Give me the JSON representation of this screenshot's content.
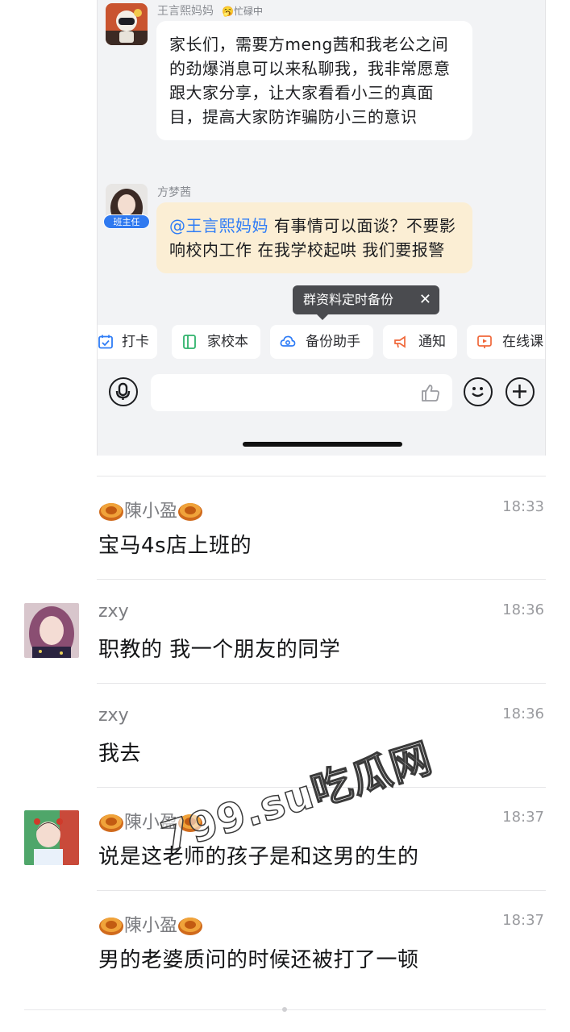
{
  "embed": {
    "sender1": {
      "name": "王言熙妈妈",
      "status": "🥱忙碌中"
    },
    "message1": "家长们，需要方meng茜和我老公之间的劲爆消息可以来私聊我，我非常愿意跟大家分享，让大家看看小三的真面目，提高大家防诈骗防小三的意识",
    "sender2": {
      "name": "方梦茜",
      "role": "班主任"
    },
    "message2": {
      "mention": "@王言熙妈妈",
      "text": " 有事情可以面谈？不要影响校内工作  在我学校起哄  我们要报警"
    },
    "tooltip": {
      "text": "群资料定时备份",
      "close": "✕"
    },
    "quick_actions": [
      {
        "label": "打卡",
        "icon": "calendar-check-icon",
        "color": "#2e7cf6"
      },
      {
        "label": "家校本",
        "icon": "notebook-icon",
        "color": "#2fb36b"
      },
      {
        "label": "备份助手",
        "icon": "cloud-backup-icon",
        "color": "#2e7cf6"
      },
      {
        "label": "通知",
        "icon": "megaphone-icon",
        "color": "#f0683a"
      },
      {
        "label": "在线课",
        "icon": "live-class-icon",
        "color": "#f0683a"
      }
    ]
  },
  "messages": [
    {
      "name": "陳小盈",
      "time": "18:33",
      "text": "宝马4s店上班的",
      "avatar": null
    },
    {
      "name": "zxy",
      "time": "18:36",
      "text": "职教的 我一个朋友的同学",
      "avatar": "girl-photo"
    },
    {
      "name": "zxy",
      "time": "18:36",
      "text": "我去",
      "avatar": null
    },
    {
      "name": "陳小盈",
      "time": "18:37",
      "text": "说是这老师的孩子是和这男的生的",
      "avatar": "child-photo"
    },
    {
      "name": "陳小盈",
      "time": "18:37",
      "text": "男的老婆质问的时候还被打了一顿",
      "avatar": null
    }
  ],
  "watermark": "799.su吃瓜网",
  "colors": {
    "accent": "#2e7cf6",
    "bubble_yellow": "#fbeed4",
    "teacher_tag": "#2f79f0"
  }
}
